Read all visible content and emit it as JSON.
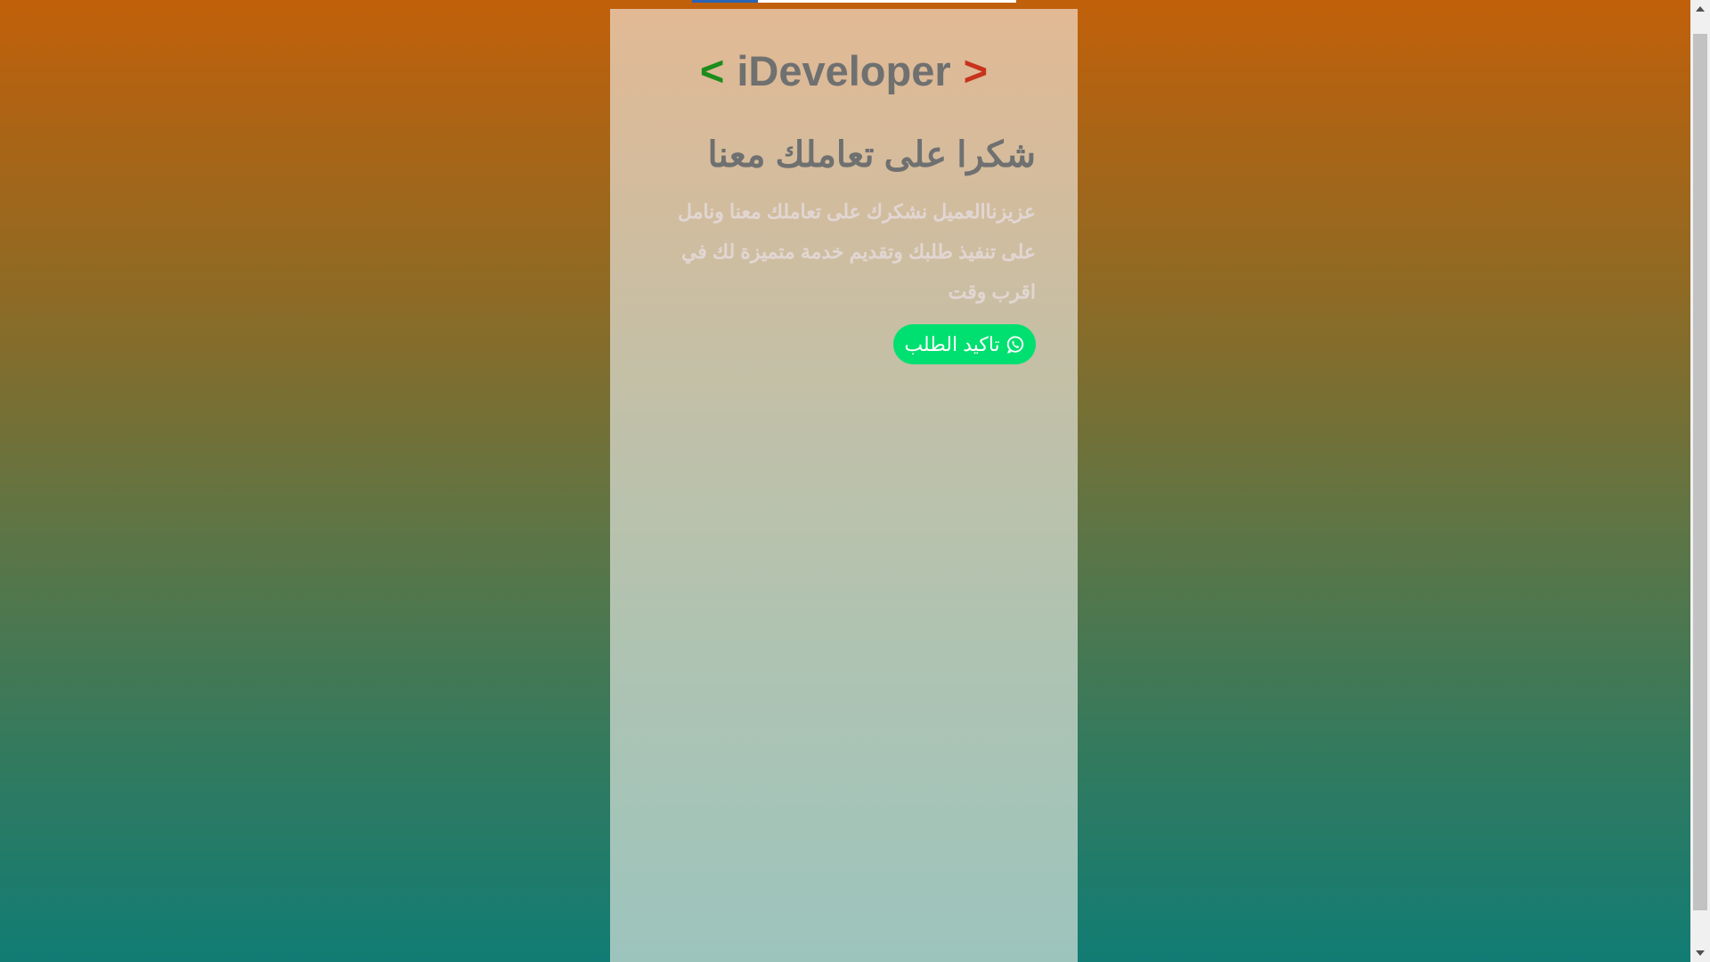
{
  "logo": {
    "open_bracket": "<",
    "name": "iDeveloper",
    "close_bracket": ">"
  },
  "heading": "شكرا على تعاملك معنا",
  "message": "عزيزناالعميل نشكرك على تعاملك معنا ونامل على تنفيذ طلبك وتقديم خدمة متميزة لك في اقرب وقت",
  "confirm_button": {
    "label": "تاكيد الطلب",
    "icon": "whatsapp-icon"
  },
  "colors": {
    "open_bracket": "#1c8c1c",
    "close_bracket": "#c8321c",
    "button": "#00e070"
  }
}
